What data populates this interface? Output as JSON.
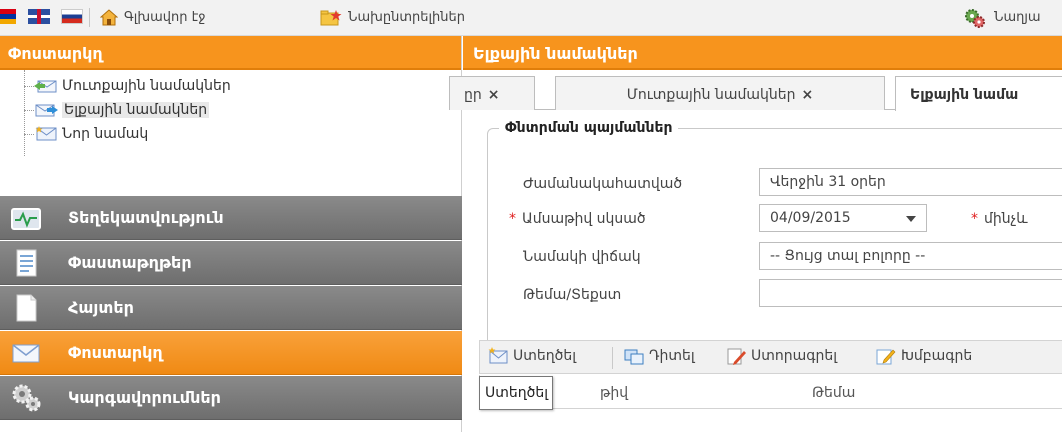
{
  "topbar": {
    "home_label": "Գլխավոր էջ",
    "preferences_label": "Նախընտրելիներ",
    "settings_label": "Նաղյա"
  },
  "left": {
    "header": "Փոստարկղ",
    "tree": [
      {
        "label": "Մուտքային նամակներ",
        "icon": "inbox-icon"
      },
      {
        "label": "Ելքային նամակներ",
        "icon": "outbox-icon"
      },
      {
        "label": "Նոր նամակ",
        "icon": "new-mail-icon"
      }
    ],
    "nav": [
      {
        "label": "Տեղեկատվություն",
        "icon": "monitor-icon",
        "style": "grey"
      },
      {
        "label": "Փաստաթղթեր",
        "icon": "documents-icon",
        "style": "grey"
      },
      {
        "label": "Հայտեր",
        "icon": "request-icon",
        "style": "grey"
      },
      {
        "label": "Փոստարկղ",
        "icon": "mail-icon",
        "style": "orange"
      },
      {
        "label": "Կարգավորումներ",
        "icon": "gears-icon",
        "style": "grey"
      }
    ]
  },
  "right": {
    "header": "Ելքային նամակներ",
    "tabs": [
      {
        "label": "ըր",
        "close": "×"
      },
      {
        "label": "Մուտքային նամակներ",
        "close": "×"
      },
      {
        "label": "Ելքային նամա"
      }
    ],
    "search": {
      "legend": "Փնտրման պայմաններ",
      "period_label": "Ժամանակահատված",
      "period_value": "Վերջին 31 օրեր",
      "date_from_label": "Ամսաթիվ սկսած",
      "date_from_value": "04/09/2015",
      "date_to_label": "մինչև",
      "status_label": "Նամակի վիճակ",
      "status_value": "-- Ցույց տալ բոլորը --",
      "subject_label": "Թեմա/Տեքստ",
      "subject_value": ""
    },
    "toolbar": {
      "create": "Ստեղծել",
      "view": "Դիտել",
      "sign": "Ստորագրել",
      "edit": "Խմբագրե"
    },
    "grid": {
      "col_date": "թիվ",
      "col_subject": "Թեմա"
    },
    "tooltip": "Ստեղծել"
  },
  "colors": {
    "accent": "#f7941d",
    "nav_grey": "#7a7a7a"
  }
}
